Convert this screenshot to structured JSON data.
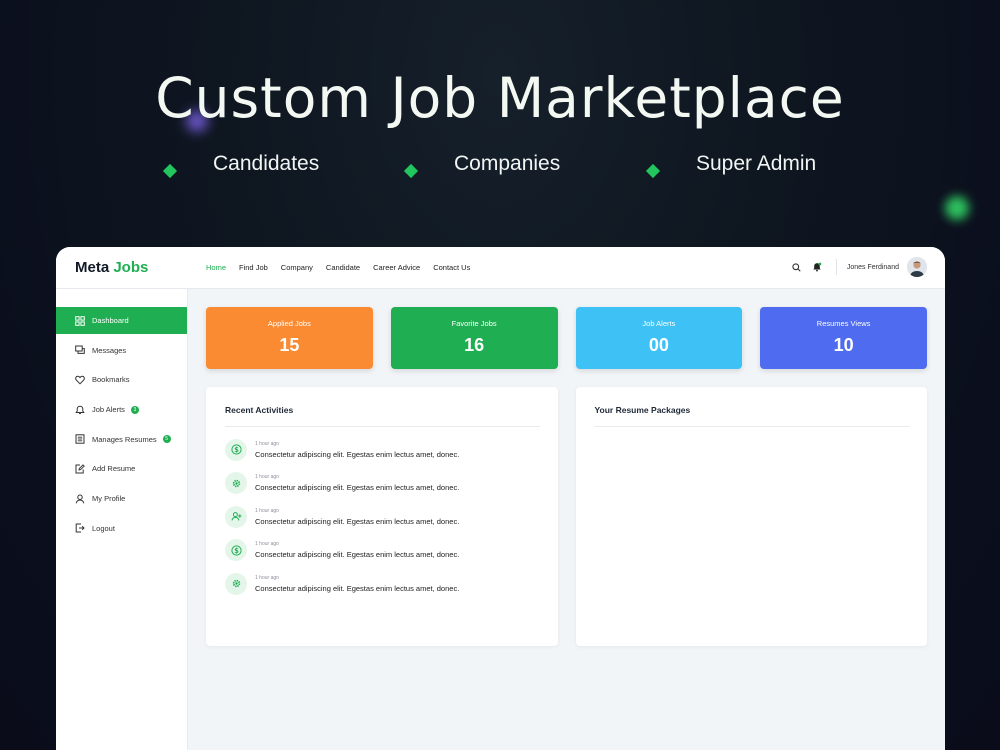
{
  "hero": {
    "title": "Custom Job Marketplace",
    "audiences": [
      "Candidates",
      "Companies",
      "Super Admin"
    ],
    "accent_color": "#22c55e"
  },
  "app": {
    "logo": {
      "part1": "Meta ",
      "part2": "Jobs"
    },
    "nav": [
      {
        "label": "Home",
        "active": true
      },
      {
        "label": "Find Job"
      },
      {
        "label": "Company"
      },
      {
        "label": "Candidate"
      },
      {
        "label": "Career Advice"
      },
      {
        "label": "Contact Us"
      }
    ],
    "user": {
      "name": "Jones Ferdinand"
    },
    "sidebar": [
      {
        "label": "Dashboard",
        "icon": "dashboard-icon",
        "active": true
      },
      {
        "label": "Messages",
        "icon": "messages-icon"
      },
      {
        "label": "Bookmarks",
        "icon": "heart-icon"
      },
      {
        "label": "Job Alerts",
        "icon": "bell-icon",
        "badge": "3"
      },
      {
        "label": "Manages Resumes",
        "icon": "resume-icon",
        "badge": "5"
      },
      {
        "label": "Add Resume",
        "icon": "add-resume-icon"
      },
      {
        "label": "My Profile",
        "icon": "user-icon"
      },
      {
        "label": "Logout",
        "icon": "logout-icon"
      }
    ],
    "stats": [
      {
        "label": "Applied Jobs",
        "value": "15",
        "color": "#fa8b32"
      },
      {
        "label": "Favorite Jobs",
        "value": "16",
        "color": "#1fae52"
      },
      {
        "label": "Job Alerts",
        "value": "00",
        "color": "#3ec2f5"
      },
      {
        "label": "Resumes Views",
        "value": "10",
        "color": "#4f6bef"
      }
    ],
    "recent_activities": {
      "title": "Recent Activities",
      "items": [
        {
          "time": "1 hour ago",
          "text": "Consectetur adipiscing elit. Egestas enim lectus amet, donec.",
          "icon": "dollar-icon"
        },
        {
          "time": "1 hour ago",
          "text": "Consectetur adipiscing elit. Egestas enim lectus amet, donec.",
          "icon": "gear-icon"
        },
        {
          "time": "1 hour ago",
          "text": "Consectetur adipiscing elit. Egestas enim lectus amet, donec.",
          "icon": "user-plus-icon"
        },
        {
          "time": "1 hour ago",
          "text": "Consectetur adipiscing elit. Egestas enim lectus amet, donec.",
          "icon": "dollar-icon"
        },
        {
          "time": "1 hour ago",
          "text": "Consectetur adipiscing elit. Egestas enim lectus amet, donec.",
          "icon": "gear-icon"
        }
      ]
    },
    "resume_packages": {
      "title": "Your Resume Packages"
    }
  }
}
